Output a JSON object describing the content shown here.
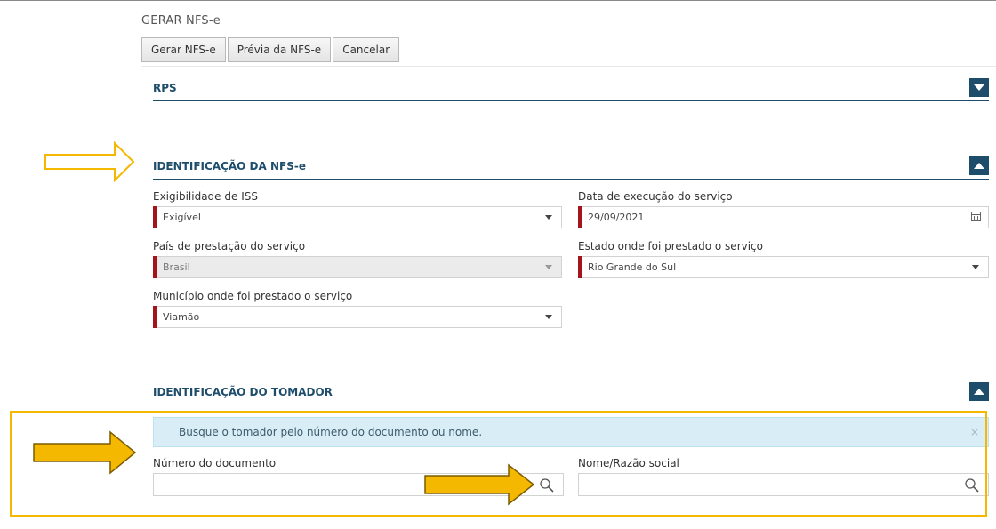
{
  "page": {
    "title": "GERAR NFS-e"
  },
  "toolbar": {
    "gerar": "Gerar NFS-e",
    "previa": "Prévia da NFS-e",
    "cancelar": "Cancelar"
  },
  "sections": {
    "rps": {
      "title": "RPS",
      "state": "collapsed"
    },
    "identificacao": {
      "title": "IDENTIFICAÇÃO DA NFS-e",
      "state": "expanded"
    },
    "tomador": {
      "title": "IDENTIFICAÇÃO DO TOMADOR",
      "state": "expanded"
    }
  },
  "form": {
    "exigibilidade": {
      "label": "Exigibilidade de ISS",
      "value": "Exigível"
    },
    "data_execucao": {
      "label": "Data de execução do serviço",
      "value": "29/09/2021"
    },
    "pais": {
      "label": "País de prestação do serviço",
      "value": "Brasil",
      "disabled": true
    },
    "estado": {
      "label": "Estado onde foi prestado o serviço",
      "value": "Rio Grande do Sul"
    },
    "municipio": {
      "label": "Município onde foi prestado o serviço",
      "value": "Viamão"
    }
  },
  "tomador": {
    "alert": "Busque o tomador pelo número do documento ou nome.",
    "alert_close": "×",
    "documento": {
      "label": "Número do documento",
      "value": ""
    },
    "nome": {
      "label": "Nome/Razão social",
      "value": ""
    }
  },
  "colors": {
    "accent": "#1e4d6b",
    "required": "#a4141c",
    "highlight": "#f5b800",
    "alert_bg": "#d9edf6"
  },
  "icons": [
    "chevron-down-icon",
    "chevron-up-icon",
    "calendar-icon",
    "search-icon",
    "close-icon",
    "arrow-right-icon"
  ]
}
